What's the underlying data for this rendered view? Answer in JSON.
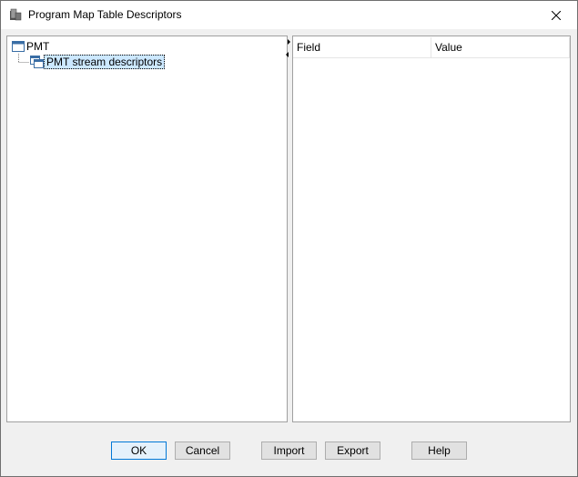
{
  "window": {
    "title": "Program Map Table Descriptors"
  },
  "tree": {
    "root": {
      "label": "PMT"
    },
    "child": {
      "label": "PMT stream descriptors"
    }
  },
  "list": {
    "columns": [
      "Field",
      "Value"
    ]
  },
  "buttons": {
    "ok": "OK",
    "cancel": "Cancel",
    "import": "Import",
    "export": "Export",
    "help": "Help"
  },
  "icons": {
    "app": "app-icon",
    "close": "close-icon",
    "tree_node": "window-icon"
  }
}
